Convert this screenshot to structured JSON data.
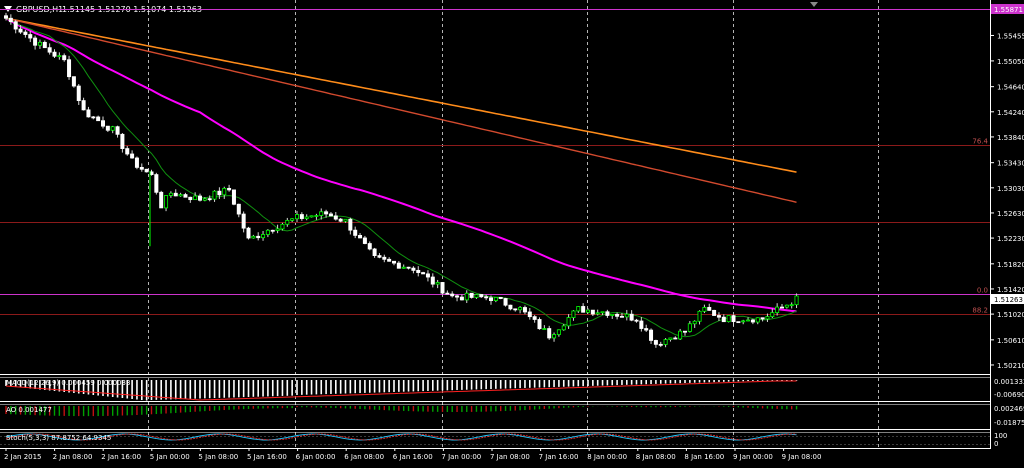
{
  "header": {
    "symbol": "GBPUSD,H1",
    "ohlc": "1.51145 1.51270 1.51074 1.51263",
    "dropdown_icon": "triangle-down-icon"
  },
  "colors": {
    "background": "#000000",
    "grid": "#c8c8c8",
    "bull_body": "#00ff00",
    "bear_body": "#ffffff",
    "ma_magenta": "#ff00ff",
    "ma_orange": "#ff8c1a",
    "ma_red": "#d24a2e",
    "ma_green": "#109010",
    "fib_line": "#8b1a1a",
    "h_magenta_line": "#cc33cc",
    "price_label_bg": "#ffffff",
    "price_label_fg": "#000000"
  },
  "price_axis": {
    "ticks": [
      "1.55455",
      "1.55050",
      "1.54640",
      "1.54240",
      "1.53840",
      "1.53430",
      "1.53030",
      "1.52630",
      "1.52230",
      "1.51820",
      "1.51420",
      "1.51020",
      "1.50610",
      "1.50210"
    ],
    "current_price": "1.51263",
    "upper_label": "1.55871"
  },
  "fib_labels": [
    "76.4",
    "0.0",
    "88.2"
  ],
  "time_axis": [
    "2 Jan 2015",
    "2 Jan 08:00",
    "2 Jan 16:00",
    "5 Jan 00:00",
    "5 Jan 08:00",
    "5 Jan 16:00",
    "6 Jan 00:00",
    "6 Jan 08:00",
    "6 Jan 16:00",
    "7 Jan 00:00",
    "7 Jan 08:00",
    "7 Jan 16:00",
    "8 Jan 00:00",
    "8 Jan 08:00",
    "8 Jan 16:00",
    "9 Jan 00:00",
    "9 Jan 08:00"
  ],
  "panels": {
    "macd": {
      "label": "MACD(12,26,9) 0.000459 0.000033",
      "ticks": [
        "0.001332",
        "-0.006901"
      ]
    },
    "ao": {
      "label": "AO 0.001477",
      "ticks": [
        "0.002469",
        "-0.018757"
      ]
    },
    "stoch": {
      "label": "Stoch(5,3,3) 87.8752 64.9345",
      "ticks": [
        "100",
        "0"
      ]
    }
  },
  "chart_data": {
    "type": "candlestick",
    "symbol": "GBPUSD",
    "timeframe": "H1",
    "ylim": [
      1.5013,
      1.5594
    ],
    "close_points": [
      {
        "i": 0,
        "price": 1.5573
      },
      {
        "i": 6,
        "price": 1.5535
      },
      {
        "i": 12,
        "price": 1.5505
      },
      {
        "i": 16,
        "price": 1.5425
      },
      {
        "i": 22,
        "price": 1.5395
      },
      {
        "i": 26,
        "price": 1.5345
      },
      {
        "i": 30,
        "price": 1.5322
      },
      {
        "i": 32,
        "price": 1.5275
      },
      {
        "i": 34,
        "price": 1.5295
      },
      {
        "i": 40,
        "price": 1.5285
      },
      {
        "i": 46,
        "price": 1.53
      },
      {
        "i": 50,
        "price": 1.522
      },
      {
        "i": 55,
        "price": 1.524
      },
      {
        "i": 60,
        "price": 1.5255
      },
      {
        "i": 66,
        "price": 1.5262
      },
      {
        "i": 70,
        "price": 1.525
      },
      {
        "i": 76,
        "price": 1.519
      },
      {
        "i": 84,
        "price": 1.5175
      },
      {
        "i": 92,
        "price": 1.513
      },
      {
        "i": 100,
        "price": 1.5128
      },
      {
        "i": 106,
        "price": 1.511
      },
      {
        "i": 112,
        "price": 1.5068
      },
      {
        "i": 118,
        "price": 1.511
      },
      {
        "i": 124,
        "price": 1.5105
      },
      {
        "i": 130,
        "price": 1.5095
      },
      {
        "i": 134,
        "price": 1.5055
      },
      {
        "i": 140,
        "price": 1.5075
      },
      {
        "i": 144,
        "price": 1.511
      },
      {
        "i": 148,
        "price": 1.5095
      },
      {
        "i": 156,
        "price": 1.5095
      },
      {
        "i": 163,
        "price": 1.5126
      }
    ],
    "moving_averages": [
      {
        "color": "magenta",
        "start": 1.5573,
        "end": 1.5124
      },
      {
        "color": "orange",
        "start": 1.5573,
        "end": 1.5328
      },
      {
        "color": "red",
        "start": 1.5573,
        "end": 1.528
      },
      {
        "color": "green",
        "start": 1.5573,
        "end": 1.5102
      }
    ],
    "horizontal_lines": [
      {
        "price": 1.55871,
        "color": "magenta"
      },
      {
        "price": 1.5371,
        "label": "76.4",
        "color": "darkred"
      },
      {
        "price": 1.5249,
        "color": "darkred"
      },
      {
        "price": 1.5134,
        "label": "0.0",
        "color": "magenta"
      },
      {
        "price": 1.5102,
        "label": "88.2",
        "color": "darkred"
      }
    ],
    "grid": true
  }
}
